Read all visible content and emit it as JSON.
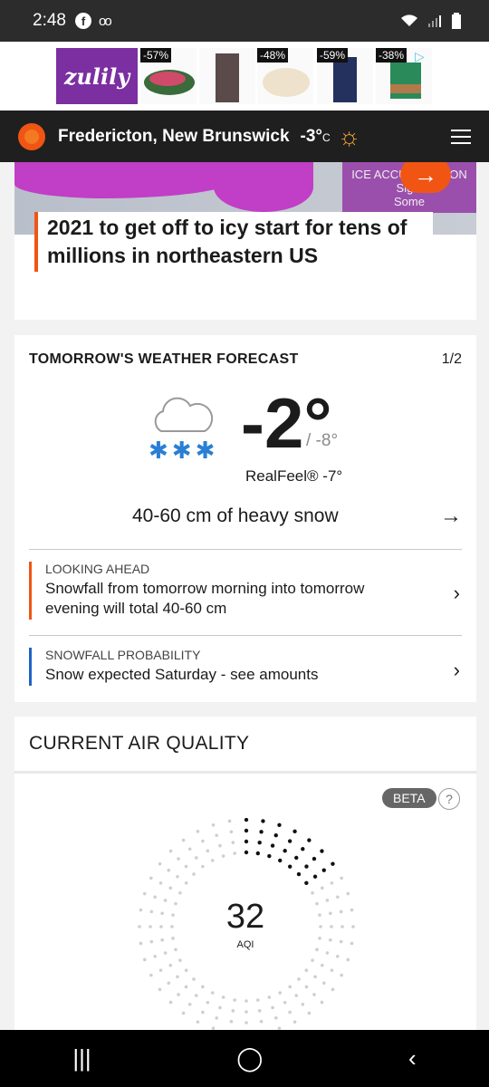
{
  "status": {
    "time": "2:48",
    "fb": "f",
    "vm": "oo"
  },
  "ad": {
    "brand": "zulily",
    "discounts": [
      "-57%",
      "-48%",
      "-59%",
      "-38%"
    ],
    "adchoices": "▷"
  },
  "header": {
    "location": "Fredericton, New Brunswick",
    "temp": "-3°",
    "unit": "C"
  },
  "news": {
    "headline": "2021 to get off to icy start for tens of millions in northeastern US",
    "map_legend_1": "ICE ACCUMULATION",
    "map_legend_2": "Signi",
    "map_legend_3": "Some"
  },
  "forecast": {
    "title": "TOMORROW'S WEATHER FORECAST",
    "page": "1/2",
    "high": "-2°",
    "low": "/ -8°",
    "realfeel": "RealFeel® -7°",
    "phrase": "40-60 cm of heavy snow",
    "alerts": [
      {
        "kicker": "LOOKING AHEAD",
        "text": "Snowfall from tomorrow morning into tomorrow evening will total 40-60 cm",
        "color": "#f05514"
      },
      {
        "kicker": "SNOWFALL PROBABILITY",
        "text": "Snow expected Saturday - see amounts",
        "color": "#1e64c8"
      }
    ]
  },
  "aq": {
    "title": "CURRENT AIR QUALITY",
    "beta": "BETA",
    "help": "?",
    "aqi": "32",
    "aqi_label": "AQI",
    "aqi_fraction": 0.16
  },
  "colors": {
    "accent": "#f05514",
    "sun": "#f4a431",
    "snow": "#2a7fd4"
  },
  "icons": [
    "facebook-icon",
    "voicemail-icon",
    "wifi-icon",
    "signal-icon",
    "battery-icon",
    "sun-icon",
    "menu-icon",
    "cloud-snow-icon",
    "arrow-right-icon",
    "chevron-right-icon",
    "recent-apps-icon",
    "home-icon",
    "back-icon"
  ]
}
